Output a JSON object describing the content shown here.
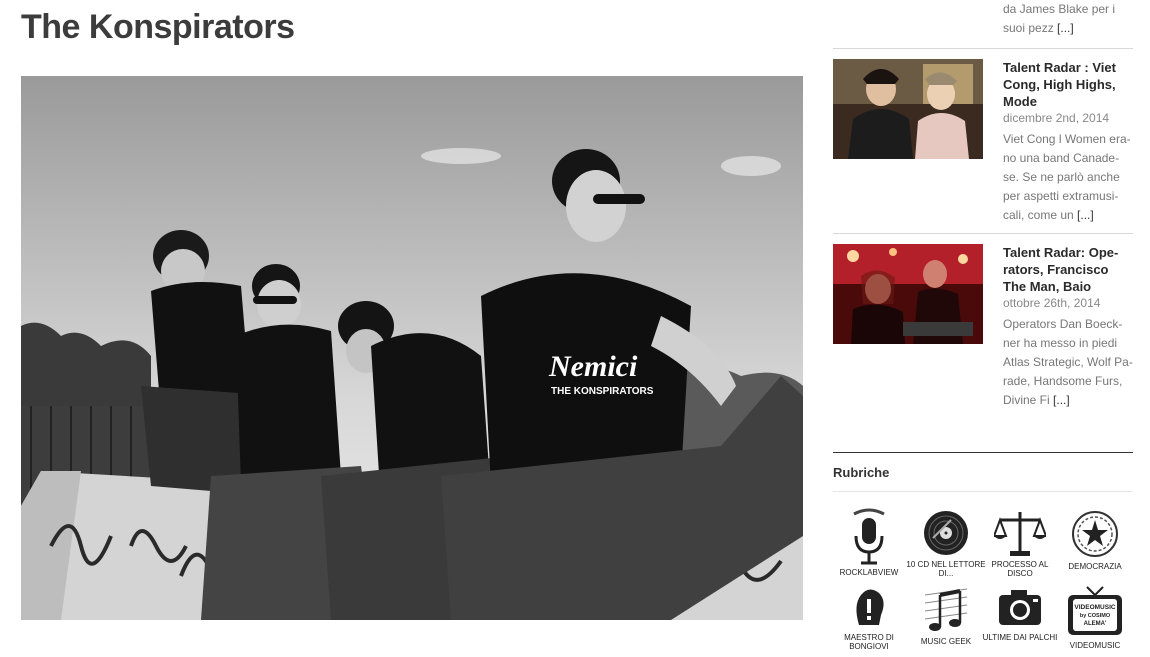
{
  "article": {
    "title": "The Konspirators",
    "photo": {
      "shirt_logo": "Nemici",
      "shirt_sub": "THE KONSPIRATORS"
    }
  },
  "sidebar": {
    "previous_post_tail": {
      "line1": "da James Blake per i",
      "line2": "suoi pezz",
      "more": "[...]"
    },
    "posts": [
      {
        "title": "Talent Radar : Viet Cong, High Highs, Mode",
        "date": "dicembre 2nd, 2014",
        "excerpt": "Viet Cong l Women era-no una band Canade-se. Se ne parlò anche per aspetti extramusi-cali, come un",
        "more": "[...]"
      },
      {
        "title": "Talent Radar: Ope-rators, Francisco The Man, Baio",
        "date": "ottobre 26th, 2014",
        "excerpt": "Operators Dan Boeck-ner ha messo in piedi Atlas Strategic, Wolf Pa-rade, Handsome Furs, Divine Fi",
        "more": "[...]"
      }
    ],
    "rubriche": {
      "title": "Rubriche",
      "items": [
        {
          "label": "ROCKLABVIEW",
          "icon": "microphone-icon"
        },
        {
          "label": "10 CD NEL LETTORE DI...",
          "icon": "vinyl-record-icon"
        },
        {
          "label": "PROCESSO AL DISCO",
          "icon": "scales-icon"
        },
        {
          "label": "DEMOCRAZIA",
          "icon": "emblem-icon"
        },
        {
          "label": "MAESTRO DI BONGIOVI",
          "icon": "head-silhouette-icon"
        },
        {
          "label": "MUSIC GEEK",
          "icon": "music-notes-icon"
        },
        {
          "label": "ULTIME DAI PALCHI",
          "icon": "camera-icon"
        },
        {
          "label": "VIDEOMUSIC",
          "icon": "tv-icon"
        }
      ],
      "tv_text": "VIDEOMUSIC by COSIMO ALEMA'"
    }
  }
}
